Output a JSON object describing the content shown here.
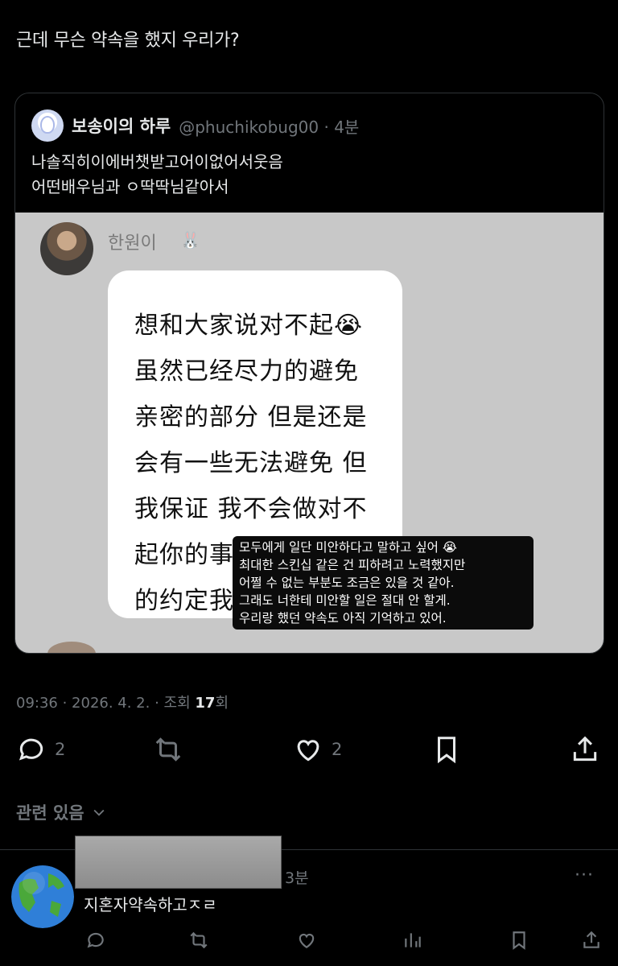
{
  "post": {
    "text": "근데 무슨 약속을 했지 우리가?",
    "meta": {
      "time_date": "09:36 · 2026. 4. 2. · 조회 ",
      "views": "17",
      "views_suffix": "회"
    },
    "actions": {
      "reply_count": "2",
      "like_count": "2"
    }
  },
  "quote": {
    "name": "보송이의 하루",
    "handle": "@phuchikobug00 · 4분",
    "lines": [
      "나솔직히이에버챗받고어이없어서웃음",
      "어떤배우님과 ㅇ딱딱님같아서"
    ],
    "image": {
      "story_name": "한원이",
      "bunny": "🐰",
      "bubble_lines": [
        "想和大家说对不起😭",
        "虽然已经尽力的避免",
        "亲密的部分 但是还是",
        "会有一些无法避免 但",
        "我保证 我不会做对不",
        "起你的事情 我和大家",
        "的约定我"
      ],
      "caption_lines": [
        "모두에게 일단 미안하다고 말하고 싶어 😭",
        "최대한 스킨십 같은 건 피하려고 노력했지만",
        "어쩔 수 없는 부분도 조금은 있을 것 같아.",
        "그래도 너한테 미안할 일은 절대 안 할게.",
        "우리랑 했던 약속도 아직 기억하고 있어."
      ]
    }
  },
  "related": {
    "label": "관련 있음"
  },
  "reply": {
    "time": "3분",
    "more": "···",
    "text": "지혼자약속하고ㅈㄹ"
  },
  "icons": [
    "reply-icon",
    "retweet-icon",
    "like-icon",
    "bookmark-icon",
    "share-icon",
    "chevron-down-icon",
    "views-icon",
    "more-icon",
    "globe-icon"
  ],
  "colors": {
    "background": "#000000",
    "text": "#e7e9ea",
    "secondary": "#71767b",
    "border": "#2f3336"
  }
}
